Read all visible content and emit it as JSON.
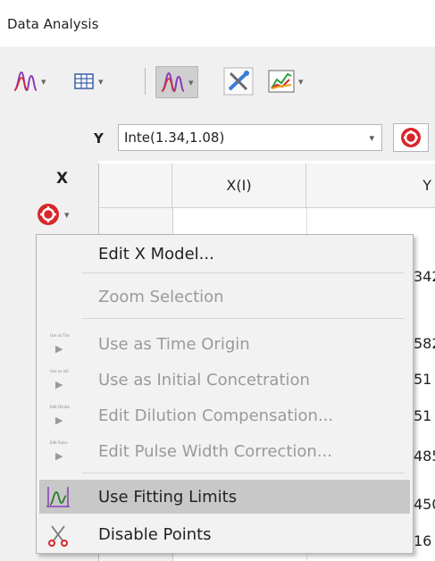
{
  "panel": {
    "title": "Data Analysis"
  },
  "toolbar": {
    "dropdown_glyph": "▾"
  },
  "y_selector": {
    "label": "Y",
    "value": "Inte(1.34,1.08)",
    "arrow": "▾"
  },
  "x_selector": {
    "label": "X"
  },
  "grid": {
    "columns": [
      "",
      "X(I)",
      "Y"
    ],
    "visible_cell_fragments": [
      "342",
      "582",
      "51",
      "51",
      "485",
      "450",
      "16"
    ]
  },
  "context_menu": {
    "items": [
      {
        "label": "Edit X Model...",
        "enabled": true
      },
      {
        "label": "Zoom Selection",
        "enabled": false
      },
      {
        "label": "Use as Time Origin",
        "enabled": false,
        "icon_caption": "Use as Tim"
      },
      {
        "label": "Use as Initial Concetration",
        "enabled": false,
        "icon_caption": "Use as Init"
      },
      {
        "label": "Edit Dilution Compensation...",
        "enabled": false,
        "icon_caption": "Edit Dilutio"
      },
      {
        "label": "Edit Pulse Width Correction...",
        "enabled": false,
        "icon_caption": "Edit Pulse"
      },
      {
        "label": "Use Fitting Limits",
        "enabled": true,
        "highlighted": true
      },
      {
        "label": "Disable Points",
        "enabled": true
      }
    ]
  },
  "colors": {
    "accent_red": "#d9262b",
    "curve_purple": "#8a3ab9",
    "highlight": "#c8c8c8",
    "toolbar_bg": "#f0f0f0"
  },
  "icons": [
    "peak-curve-icon",
    "table-icon",
    "peak-curve-active-icon",
    "tools-icon",
    "plot-icon",
    "settings-gear-icon",
    "fitting-limits-icon",
    "scissors-icon",
    "play-arrow-icon"
  ]
}
